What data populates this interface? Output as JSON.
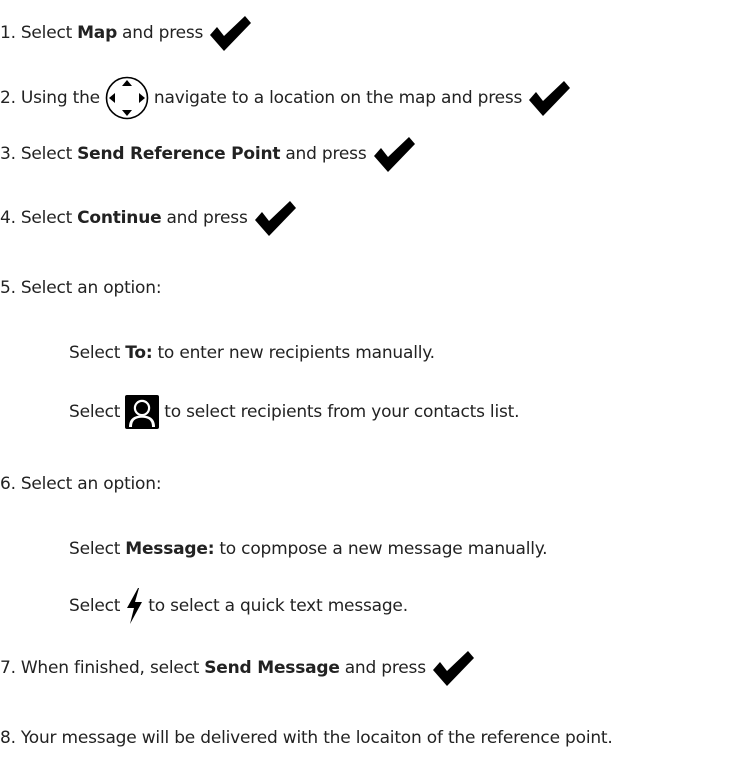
{
  "steps": [
    {
      "num": "1.",
      "pre": "Select",
      "bold": "Map",
      "post": "and press"
    },
    {
      "num": "2.",
      "pre": "Using the",
      "post": "navigate to a location on the map and press"
    },
    {
      "num": "3.",
      "pre": "Select",
      "bold": "Send Reference Point",
      "post": "and press"
    },
    {
      "num": "4.",
      "pre": "Select",
      "bold": "Continue",
      "post": "and press"
    },
    {
      "num": "5.",
      "text": "Select an option:"
    },
    {
      "num": "6.",
      "text": "Select an option:"
    },
    {
      "num": "7.",
      "pre": "When finished, select",
      "bold": "Send Message",
      "post": "and press"
    },
    {
      "num": "8.",
      "text": "Your message will be delivered with the locaiton of the reference point."
    }
  ],
  "sub_options": {
    "to": {
      "pre": "Select",
      "bold": "To:",
      "post": "to enter new recipients manually."
    },
    "contacts": {
      "pre": "Select",
      "post": "to select recipients from your contacts list."
    },
    "message": {
      "pre": "Select",
      "bold": "Message:",
      "post": "to copmpose a new message manually."
    },
    "quick_text": {
      "pre": "Select",
      "post": "to select a quick text message."
    }
  },
  "icons": {
    "confirm": "checkmark-icon",
    "navigate": "dpad-icon",
    "contacts": "contact-icon",
    "quick_text": "lightning-bolt-icon"
  },
  "colors": {
    "text": "#222222",
    "icon": "#000000"
  }
}
